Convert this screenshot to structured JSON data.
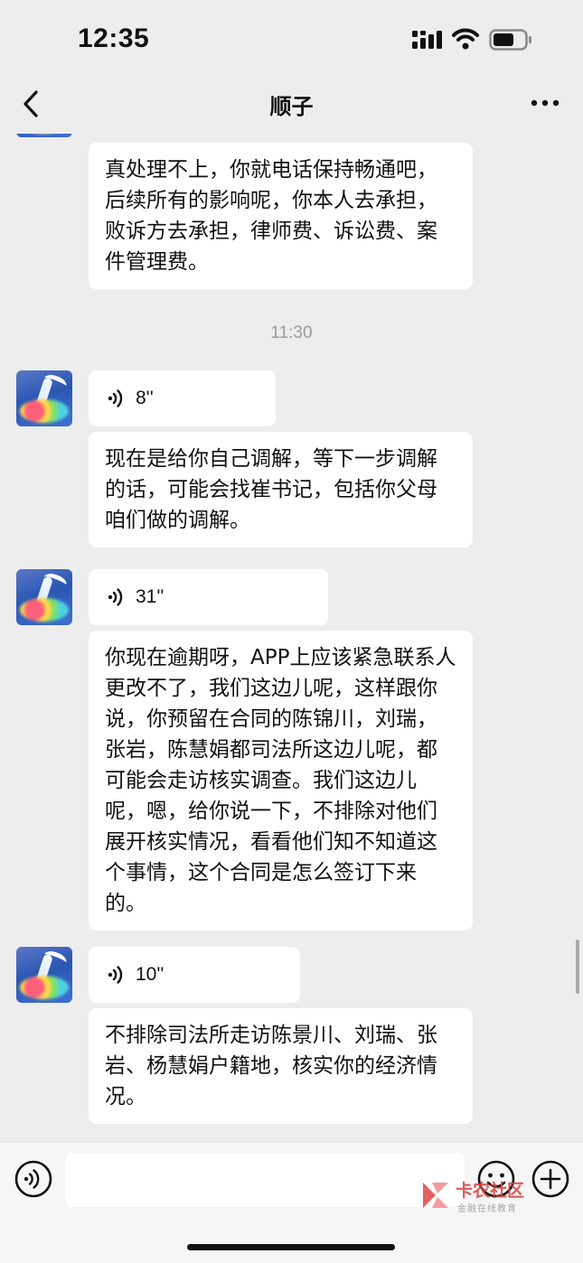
{
  "status_bar": {
    "time": "12:35"
  },
  "nav": {
    "title": "顺子",
    "back_icon": "chevron-left-icon",
    "more_icon": "more-dots-icon"
  },
  "messages": [
    {
      "type": "text",
      "text": "真处理不上，你就电话保持畅通吧，后续所有的影响呢，你本人去承担，败诉方去承担，律师费、诉讼费、案件管理费。"
    },
    {
      "type": "timestamp",
      "text": "11:30"
    },
    {
      "type": "voice",
      "duration": "8''"
    },
    {
      "type": "text",
      "text": "现在是给你自己调解，等下一步调解的话，可能会找崔书记，包括你父母咱们做的调解。"
    },
    {
      "type": "voice",
      "duration": "31''"
    },
    {
      "type": "text",
      "text": "你现在逾期呀，APP上应该紧急联系人更改不了，我们这边儿呢，这样跟你说，你预留在合同的陈锦川，刘瑞，张岩，陈慧娟都司法所这边儿呢，都可能会走访核实调查。我们这边儿呢，嗯，给你说一下，不排除对他们展开核实情况，看看他们知不知道这个事情，这个合同是怎么签订下来的。"
    },
    {
      "type": "voice",
      "duration": "10''"
    },
    {
      "type": "text",
      "text": "不排除司法所走访陈景川、刘瑞、张岩、杨慧娟户籍地，核实你的经济情况。"
    }
  ],
  "input_bar": {
    "message_value": ""
  },
  "watermark": {
    "title": "卡农社区",
    "subtitle": "金融在线教育"
  },
  "colors": {
    "background": "#ededed",
    "bubble": "#ffffff",
    "input_bar": "#f6f6f6",
    "timestamp": "#9b9b9b",
    "watermark": "#d8403f"
  }
}
